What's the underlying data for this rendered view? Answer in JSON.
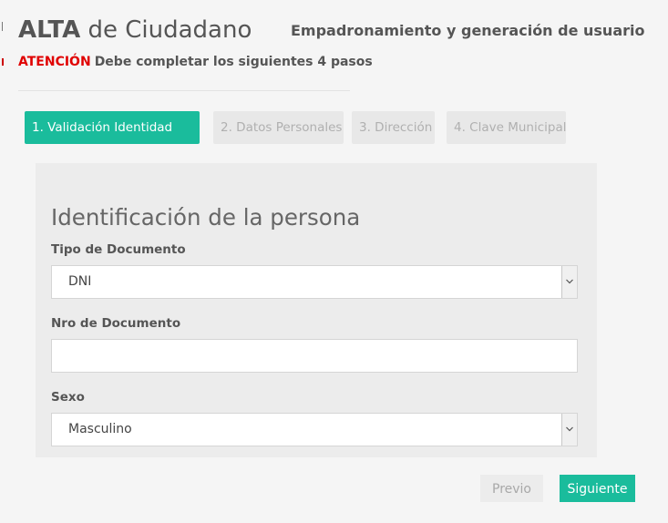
{
  "header": {
    "title_bold": "ALTA",
    "title_rest": "de Ciudadano",
    "subtitle": "Empadronamiento y generación de usuario",
    "warning_label": "ATENCIÓN",
    "warning_text": "Debe completar los siguientes 4 pasos"
  },
  "steps": [
    {
      "label": "1. Validación Identidad",
      "active": true
    },
    {
      "label": "2. Datos Personales",
      "active": false
    },
    {
      "label": "3. Dirección",
      "active": false
    },
    {
      "label": "4. Clave Municipal",
      "active": false
    }
  ],
  "form": {
    "section_title": "Identificación de la persona",
    "tipo_documento": {
      "label": "Tipo de Documento",
      "value": "DNI"
    },
    "nro_documento": {
      "label": "Nro de Documento",
      "value": ""
    },
    "sexo": {
      "label": "Sexo",
      "value": "Masculino"
    }
  },
  "buttons": {
    "prev_label": "Previo",
    "next_label": "Siguiente"
  },
  "colors": {
    "accent": "#1abc9c",
    "warning": "#e00000",
    "inactive_step_bg": "#e8e8e8"
  },
  "icons": {
    "select_arrow": "chevron-down-icon"
  }
}
